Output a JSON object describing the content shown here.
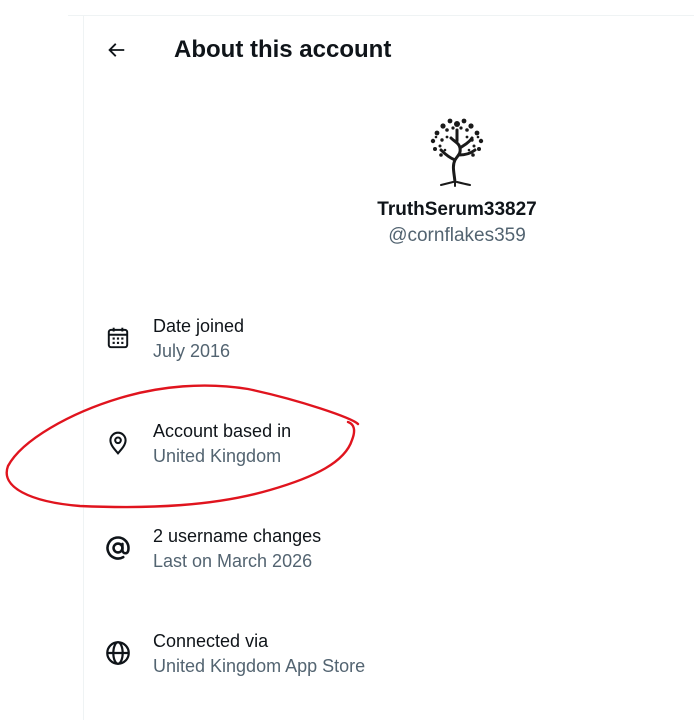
{
  "header": {
    "title": "About this account",
    "back_icon": "arrow-left-icon"
  },
  "profile": {
    "display_name": "TruthSerum33827",
    "handle": "@cornflakes359",
    "avatar_icon": "tree-avatar"
  },
  "rows": [
    {
      "icon": "calendar-icon",
      "label": "Date joined",
      "value": "July 2016"
    },
    {
      "icon": "location-pin-icon",
      "label": "Account based in",
      "value": "United Kingdom"
    },
    {
      "icon": "at-sign-icon",
      "label": "2 username changes",
      "value": "Last on March 2026"
    },
    {
      "icon": "globe-icon",
      "label": "Connected via",
      "value": "United Kingdom App Store"
    }
  ],
  "colors": {
    "primary_text": "#0f1419",
    "secondary_text": "#536471",
    "annotation_red": "#e0141e"
  }
}
